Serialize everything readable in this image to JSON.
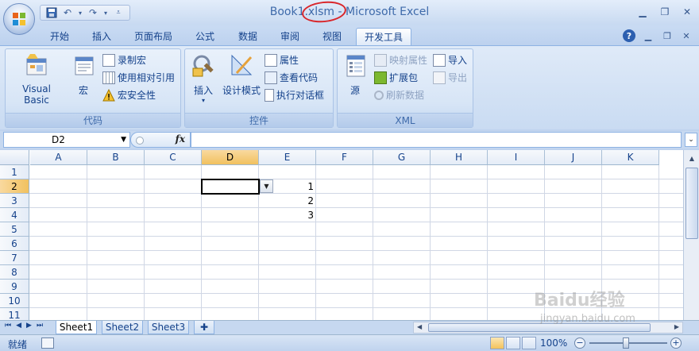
{
  "window": {
    "title": "Book1.xlsm - Microsoft Excel"
  },
  "quick_access": [
    "save-icon",
    "undo-icon",
    "redo-icon",
    "customize-icon"
  ],
  "tabs": [
    {
      "label": "开始"
    },
    {
      "label": "插入"
    },
    {
      "label": "页面布局"
    },
    {
      "label": "公式"
    },
    {
      "label": "数据"
    },
    {
      "label": "审阅"
    },
    {
      "label": "视图"
    },
    {
      "label": "开发工具",
      "active": true
    }
  ],
  "ribbon": {
    "code": {
      "label": "代码",
      "visual_basic": "Visual Basic",
      "macros": "宏",
      "record_macro": "录制宏",
      "relative_ref": "使用相对引用",
      "macro_security": "宏安全性"
    },
    "controls": {
      "label": "控件",
      "insert": "插入",
      "design_mode": "设计模式",
      "properties": "属性",
      "view_code": "查看代码",
      "run_dialog": "执行对话框"
    },
    "xml": {
      "label": "XML",
      "source": "源",
      "map_properties": "映射属性",
      "expansion_packs": "扩展包",
      "refresh_data": "刷新数据",
      "import": "导入",
      "export": "导出"
    }
  },
  "formula_bar": {
    "name_box": "D2",
    "fx": "fx",
    "formula": ""
  },
  "grid": {
    "columns": [
      "A",
      "B",
      "C",
      "D",
      "E",
      "F",
      "G",
      "H",
      "I",
      "J",
      "K"
    ],
    "rows": [
      "1",
      "2",
      "3",
      "4",
      "5",
      "6",
      "7",
      "8",
      "9",
      "10",
      "11"
    ],
    "selected_cell": "D2",
    "cells": {
      "E2": "1",
      "E3": "2",
      "E4": "3"
    }
  },
  "sheets": [
    {
      "label": "Sheet1",
      "active": true
    },
    {
      "label": "Sheet2"
    },
    {
      "label": "Sheet3"
    }
  ],
  "status": {
    "text": "就绪",
    "zoom": "100%"
  },
  "watermark": {
    "brand": "Baidu经验",
    "url": "jingyan.baidu.com"
  }
}
